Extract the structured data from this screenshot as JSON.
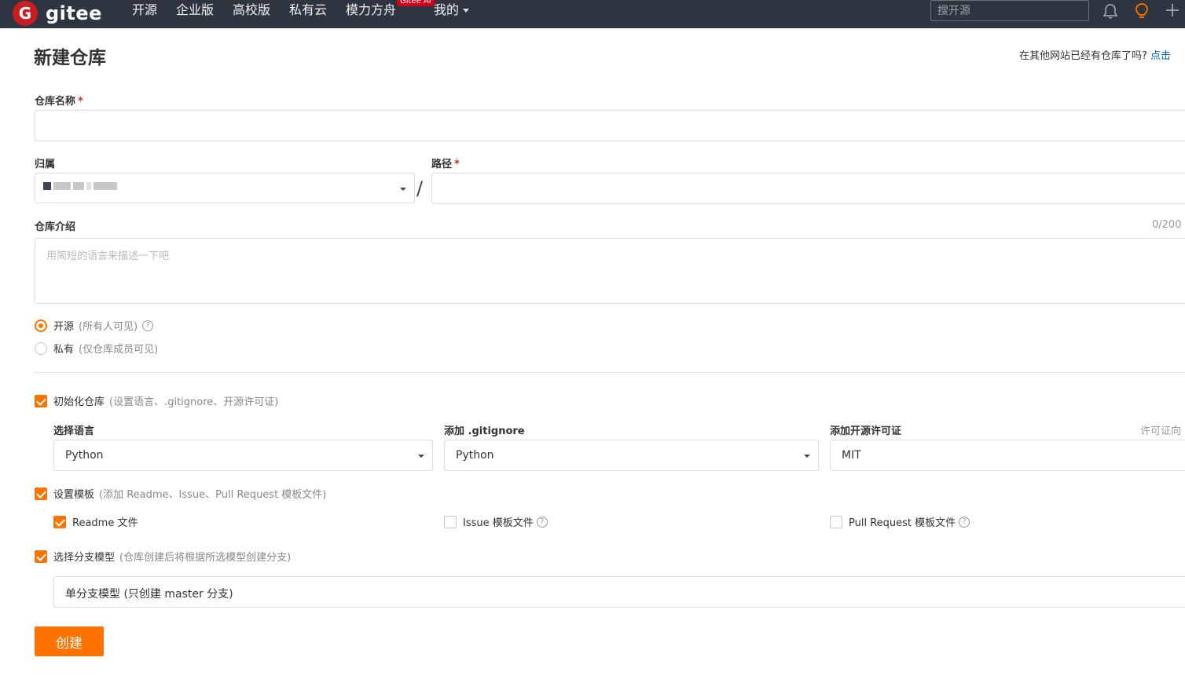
{
  "nav": {
    "logo_letter": "G",
    "logo_text": "gitee",
    "items": [
      "开源",
      "企业版",
      "高校版",
      "私有云",
      "模力方舟",
      "我的"
    ],
    "ai_badge": "Gitee AI",
    "search_placeholder": "搜开源"
  },
  "page": {
    "title": "新建仓库",
    "import_hint": "在其他网站已经有仓库了吗?",
    "import_link": "点击"
  },
  "form": {
    "repo_name_label": "仓库名称",
    "required_mark": "*",
    "owner_label": "归属",
    "path_label": "路径",
    "slash": "/",
    "desc_label": "仓库介绍",
    "desc_counter": "0/200",
    "desc_placeholder": "用简短的语言来描述一下吧",
    "visibility": [
      {
        "label": "开源",
        "hint": "(所有人可见)",
        "selected": true
      },
      {
        "label": "私有",
        "hint": "(仅仓库成员可见)",
        "selected": false
      }
    ],
    "init_repo": {
      "label": "初始化仓库",
      "hint": "(设置语言、.gitignore、开源许可证)",
      "checked": true
    },
    "language_label": "选择语言",
    "language_value": "Python",
    "gitignore_label": "添加 .gitignore",
    "gitignore_value": "Python",
    "license_label": "添加开源许可证",
    "license_value": "MIT",
    "license_link": "许可证向",
    "template": {
      "label": "设置模板",
      "hint": "(添加 Readme、Issue、Pull Request 模板文件)",
      "checked": true
    },
    "readme": {
      "label": "Readme 文件",
      "checked": true
    },
    "issue_tpl": {
      "label": "Issue 模板文件",
      "checked": false
    },
    "pr_tpl": {
      "label": "Pull Request 模板文件",
      "checked": false
    },
    "branch": {
      "label": "选择分支模型",
      "hint": "(仓库创建后将根据所选模型创建分支)",
      "checked": true
    },
    "branch_value": "单分支模型 (只创建 master 分支)",
    "create_button": "创建"
  },
  "colors": {
    "accent": "#fe7300",
    "nav_bg": "#2f3540",
    "brand_red": "#c71d23"
  },
  "icons": [
    "bell-icon",
    "bulb-icon",
    "plus-icon",
    "question-icon",
    "caret-down-icon"
  ]
}
